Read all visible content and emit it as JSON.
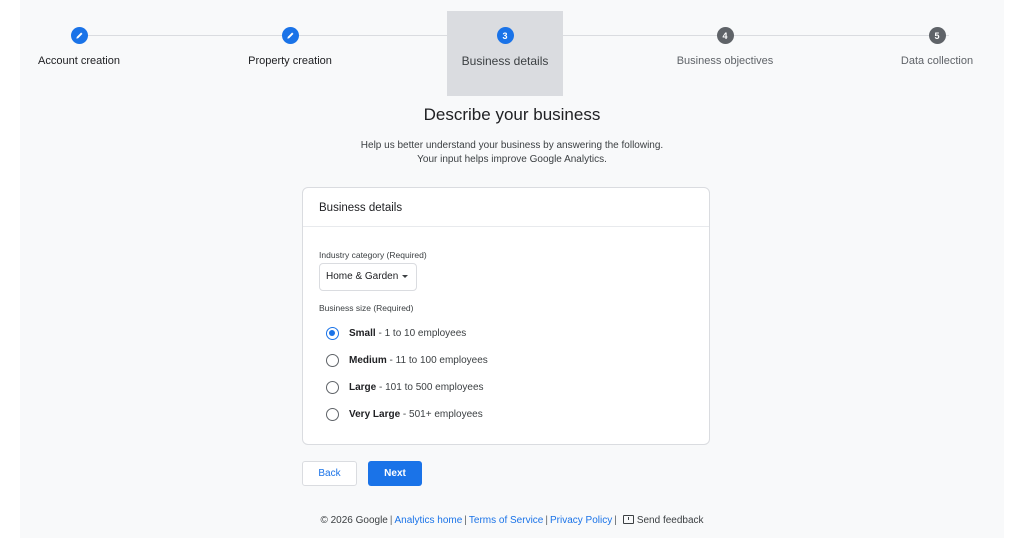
{
  "stepper": {
    "steps": [
      {
        "number": "",
        "label": "Account creation",
        "state": "done",
        "icon": "pencil-icon"
      },
      {
        "number": "",
        "label": "Property creation",
        "state": "done",
        "icon": "pencil-icon"
      },
      {
        "number": "3",
        "label": "Business details",
        "state": "current"
      },
      {
        "number": "4",
        "label": "Business objectives",
        "state": "pending"
      },
      {
        "number": "5",
        "label": "Data collection",
        "state": "pending"
      }
    ]
  },
  "main": {
    "title": "Describe your business",
    "subtitle_line1": "Help us better understand your business by answering the following.",
    "subtitle_line2": "Your input helps improve Google Analytics."
  },
  "card": {
    "header": "Business details",
    "industry_label": "Industry category (Required)",
    "industry_value": "Home & Garden",
    "size_label": "Business size (Required)",
    "sizes": [
      {
        "name": "Small",
        "detail": " - 1 to 10 employees",
        "checked": true
      },
      {
        "name": "Medium",
        "detail": " - 11 to 100 employees",
        "checked": false
      },
      {
        "name": "Large",
        "detail": " - 101 to 500 employees",
        "checked": false
      },
      {
        "name": "Very Large",
        "detail": " - 501+ employees",
        "checked": false
      }
    ]
  },
  "actions": {
    "back": "Back",
    "next": "Next"
  },
  "footer": {
    "copyright": "© 2026 Google",
    "analytics_home": "Analytics home",
    "terms": "Terms of Service",
    "privacy": "Privacy Policy",
    "feedback": "Send feedback"
  },
  "colors": {
    "accent": "#1a73e8",
    "pending": "#5f6368",
    "active_step_bg": "#dadce0",
    "page_bg": "#f8f9fa"
  }
}
